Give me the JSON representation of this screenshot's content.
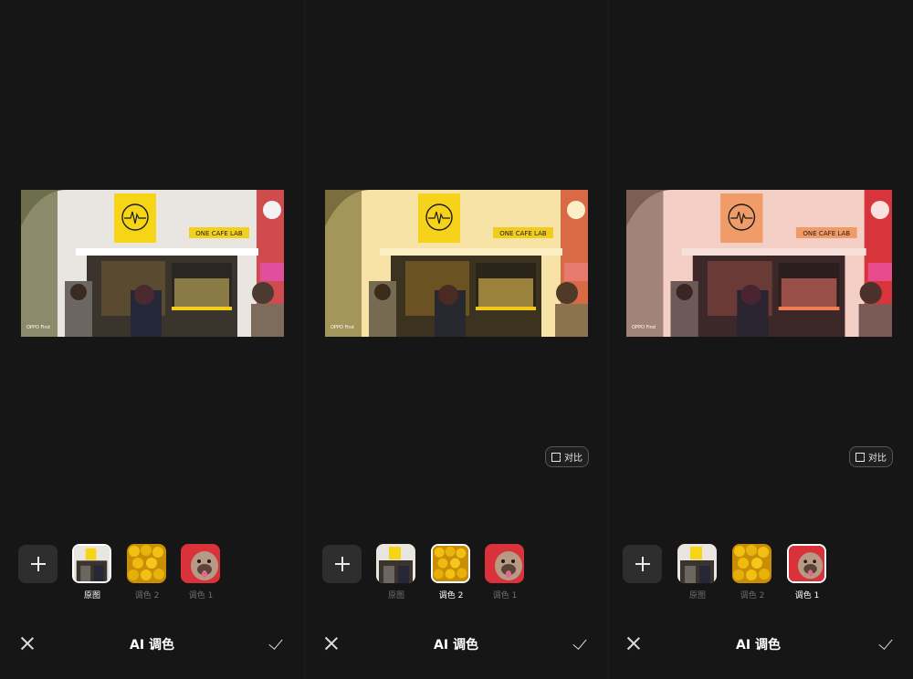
{
  "screens": [
    {
      "filter": "original",
      "compare_label": "",
      "thumbnails": [
        {
          "label": "原图",
          "active": true,
          "kind": "cafe"
        },
        {
          "label": "调色 2",
          "active": false,
          "kind": "corn"
        },
        {
          "label": "调色 1",
          "active": false,
          "kind": "dog"
        }
      ],
      "title": "AI 调色"
    },
    {
      "filter": "warm-yellow",
      "compare_label": "对比",
      "thumbnails": [
        {
          "label": "原图",
          "active": false,
          "kind": "cafe"
        },
        {
          "label": "调色 2",
          "active": true,
          "kind": "corn"
        },
        {
          "label": "调色 1",
          "active": false,
          "kind": "dog"
        }
      ],
      "title": "AI 调色"
    },
    {
      "filter": "pink",
      "compare_label": "对比",
      "thumbnails": [
        {
          "label": "原图",
          "active": false,
          "kind": "cafe"
        },
        {
          "label": "调色 2",
          "active": false,
          "kind": "corn"
        },
        {
          "label": "调色 1",
          "active": true,
          "kind": "dog"
        }
      ],
      "title": "AI 调色"
    }
  ],
  "photo": {
    "sign_text": "ONE CAFE LAB",
    "watermark": "OPPO Find"
  },
  "colors": {
    "background": "#161616",
    "active_label": "#ffffff",
    "inactive_label": "#6e6e6e",
    "logo_yellow": "#f5d516"
  }
}
